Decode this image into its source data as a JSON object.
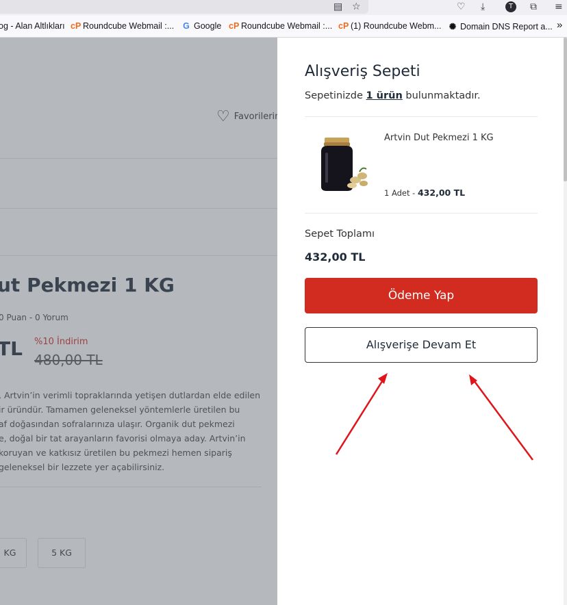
{
  "browser": {
    "bookmarks": [
      {
        "icon": "bookmark-icon",
        "label": "og - Alan Altlıkları"
      },
      {
        "icon": "cpanel-icon",
        "label": "Roundcube Webmail :..."
      },
      {
        "icon": "google-icon",
        "label": "Google"
      },
      {
        "icon": "cpanel-icon",
        "label": "Roundcube Webmail :..."
      },
      {
        "icon": "cpanel-icon",
        "label": "(1) Roundcube Webm..."
      },
      {
        "icon": "dns-icon",
        "label": "Domain DNS Report a..."
      }
    ],
    "overflow": "»",
    "account_initial": "T"
  },
  "page": {
    "favorites_label": "Favorilerin",
    "product_title": "ut Pekmezi 1 KG",
    "rating": "0 Puan - 0 Yorum",
    "price_suffix": "TL",
    "discount": "%10 İndirim",
    "old_price": "480,00 TL",
    "description_lines": [
      ", Artvin’in verimli topraklarında yetişen dutlardan elde edilen",
      "ir üründür. Tamamen geleneksel yöntemlerle üretilen bu",
      "af doğasından sofralarınıza ulaşır. Organik dut pekmezi",
      "e, doğal bir tat arayanların favorisi olmaya aday. Artvin’in",
      " koruyan ve katkısız üretilen bu pekmezi hemen sipariş",
      " geleneksel bir lezzete yer açabilirsiniz."
    ],
    "options": [
      "KG",
      "5 KG"
    ]
  },
  "cart": {
    "title": "Alışveriş Sepeti",
    "subtitle_pre": "Sepetinizde ",
    "subtitle_count": "1 ürün",
    "subtitle_post": " bulunmaktadır.",
    "item": {
      "name": "Artvin Dut Pekmezi 1 KG",
      "qty": "1 Adet - ",
      "price": "432,00 TL"
    },
    "total_label": "Sepet Toplamı",
    "total_value": "432,00 TL",
    "pay_button": "Ödeme Yap",
    "continue_button": "Alışverişe Devam Et"
  },
  "colors": {
    "accent_red": "#d22b20",
    "annotation_arrow": "#e0141b"
  }
}
